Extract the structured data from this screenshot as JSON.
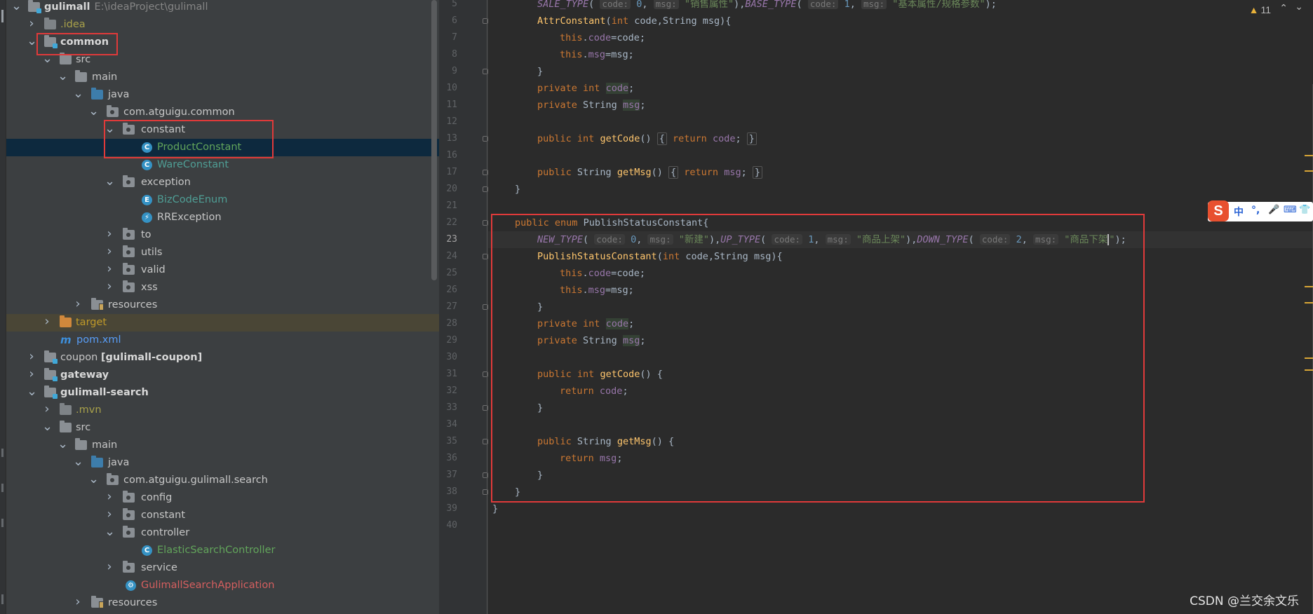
{
  "tree": {
    "rows": [
      {
        "label": "gulimall",
        "path": "E:\\ideaProject\\gulimall"
      },
      {
        "label": ".idea"
      },
      {
        "label": "common"
      },
      {
        "label": "src"
      },
      {
        "label": "main"
      },
      {
        "label": "java"
      },
      {
        "label": "com.atguigu.common"
      },
      {
        "label": "constant"
      },
      {
        "label": "ProductConstant"
      },
      {
        "label": "WareConstant"
      },
      {
        "label": "exception"
      },
      {
        "label": "BizCodeEnum"
      },
      {
        "label": "RRException"
      },
      {
        "label": "to"
      },
      {
        "label": "utils"
      },
      {
        "label": "valid"
      },
      {
        "label": "xss"
      },
      {
        "label": "resources"
      },
      {
        "label": "target"
      },
      {
        "label": "pom.xml"
      },
      {
        "label": "coupon",
        "module": "[gulimall-coupon]"
      },
      {
        "label": "gateway"
      },
      {
        "label": "gulimall-search"
      },
      {
        "label": ".mvn"
      },
      {
        "label": "src"
      },
      {
        "label": "main"
      },
      {
        "label": "java"
      },
      {
        "label": "com.atguigu.gulimall.search"
      },
      {
        "label": "config"
      },
      {
        "label": "constant"
      },
      {
        "label": "controller"
      },
      {
        "label": "ElasticSearchController"
      },
      {
        "label": "service"
      },
      {
        "label": "GulimallSearchApplication"
      },
      {
        "label": "resources"
      }
    ],
    "icons": {
      "class": "C",
      "enum": "E",
      "maven": "m"
    }
  },
  "editor": {
    "line_numbers": [
      "5",
      "6",
      "7",
      "8",
      "9",
      "10",
      "11",
      "12",
      "13",
      "16",
      "17",
      "20",
      "21",
      "22",
      "23",
      "24",
      "25",
      "26",
      "27",
      "28",
      "29",
      "30",
      "31",
      "32",
      "33",
      "34",
      "35",
      "36",
      "37",
      "38",
      "39",
      "40"
    ],
    "current_line": "23",
    "code": {
      "l5": {
        "c1": "SALE_TYPE",
        "h1": "code:",
        "n1": "0",
        "h2": "msg:",
        "s1": "\"销售属性\"",
        "c2": "BASE_TYPE",
        "h3": "code:",
        "n2": "1",
        "h4": "msg:",
        "s2": "\"基本属性/规格参数\""
      },
      "l6": {
        "fn": "AttrConstant",
        "kw": "int",
        "rest": " code,String msg){"
      },
      "this": "this",
      "code": "code",
      "msg": "msg",
      "private": "private",
      "int": "int",
      "string": "String",
      "public": "public",
      "return": "return",
      "getCode": "getCode",
      "getMsg": "getMsg",
      "enum": "enum",
      "enum_name": "PublishStatusConstant",
      "l23": {
        "c1": "NEW_TYPE",
        "h1": "code:",
        "n1": "0",
        "h2": "msg:",
        "s1": "\"新建\"",
        "c2": "UP_TYPE",
        "h3": "code:",
        "n2": "1",
        "h4": "msg:",
        "s2": "\"商品上架\"",
        "c3": "DOWN_TYPE",
        "h5": "code:",
        "n3": "2",
        "h6": "msg:",
        "s3a": "\"商品下架",
        "s3b": "\""
      },
      "ctor_name": "PublishStatusConstant"
    }
  },
  "status": {
    "warnings": "11",
    "warn_icon": "warning-triangle-icon"
  },
  "ime": {
    "logo": "S",
    "items": [
      "中",
      "°,",
      "🎤",
      "⌨",
      "👕"
    ]
  },
  "watermark": "CSDN @兰交余文乐"
}
